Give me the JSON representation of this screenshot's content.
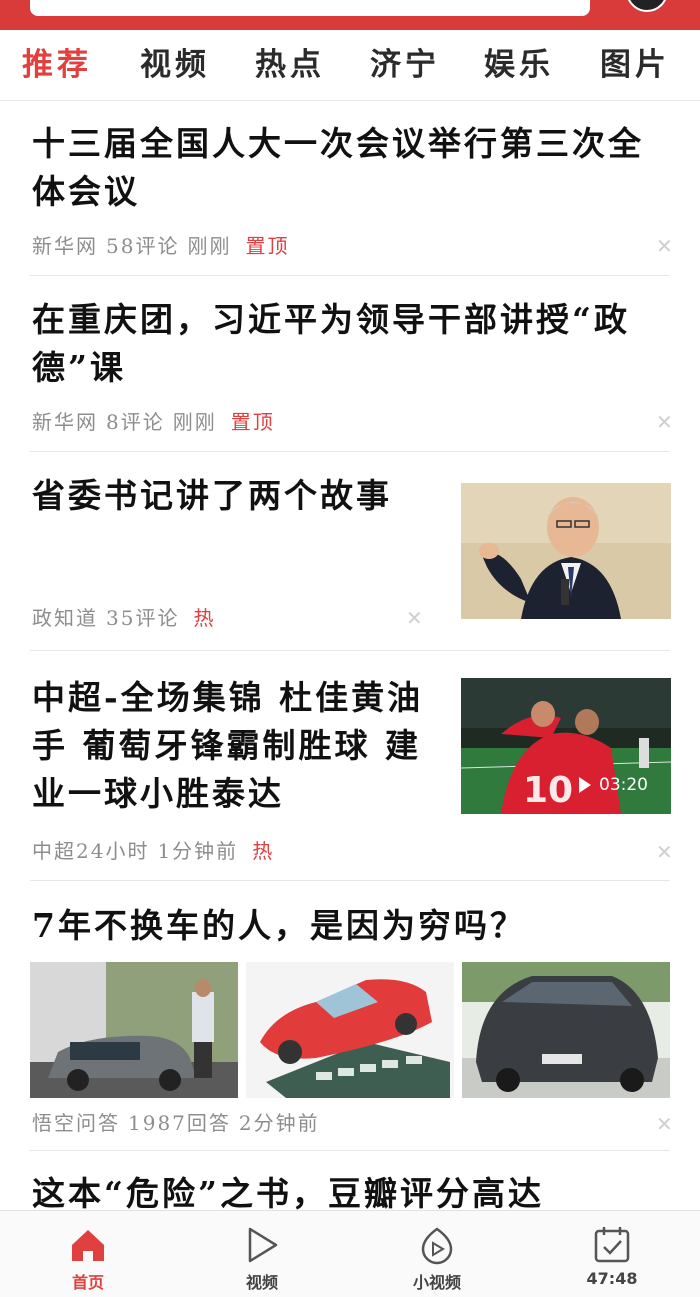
{
  "tabs": [
    "推荐",
    "视频",
    "热点",
    "济宁",
    "娱乐",
    "图片"
  ],
  "articles": [
    {
      "title": "十三届全国人大一次会议举行第三次全体会议",
      "source": "新华网",
      "comments": "58评论",
      "time": "刚刚",
      "tag": "置顶"
    },
    {
      "title": "在重庆团，习近平为领导干部讲授“政德”课",
      "source": "新华网",
      "comments": "8评论",
      "time": "刚刚",
      "tag": "置顶"
    },
    {
      "title": "省委书记讲了两个故事",
      "source": "政知道",
      "comments": "35评论",
      "tag": "热"
    },
    {
      "title": "中超-全场集锦 杜佳黄油手 葡萄牙锋霸制胜球 建业一球小胜泰达",
      "source": "中超24小时",
      "time": "1分钟前",
      "tag": "热",
      "duration": "03:20"
    },
    {
      "title": "7年不换车的人，是因为穷吗？",
      "source": "悟空问答",
      "answers": "1987回答",
      "time": "2分钟前"
    },
    {
      "title": "这本“危险”之书，豆瓣评分高达"
    }
  ],
  "bottom_nav": [
    {
      "label": "首页",
      "icon": "home-icon",
      "active": true
    },
    {
      "label": "视频",
      "icon": "play-icon"
    },
    {
      "label": "小视频",
      "icon": "small-video-icon"
    },
    {
      "label": "47:48",
      "icon": "task-icon"
    }
  ],
  "colors": {
    "accent": "#e0403f",
    "topbar": "#d93a3a"
  }
}
